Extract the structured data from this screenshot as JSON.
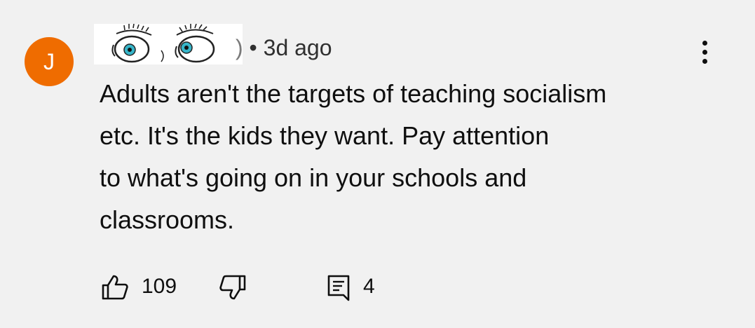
{
  "comment": {
    "author_initial": "J",
    "meta_tail": ")",
    "separator": "•",
    "time_ago": "3d ago",
    "text_lines": [
      "Adults aren't the targets of teaching socialism",
      "etc. It's the kids they want. Pay attention",
      "to what's going on in your schools and",
      "classrooms."
    ]
  },
  "actions": {
    "like_count": "109",
    "reply_count": "4",
    "like_icon": "thumbs-up-icon",
    "dislike_icon": "thumbs-down-icon",
    "reply_icon": "comment-reply-icon",
    "more_icon": "more-vertical-icon"
  },
  "colors": {
    "background": "#f1f1f1",
    "avatar": "#ef6c00",
    "text": "#0f0f0f",
    "eye_iris": "#36b5c9"
  }
}
